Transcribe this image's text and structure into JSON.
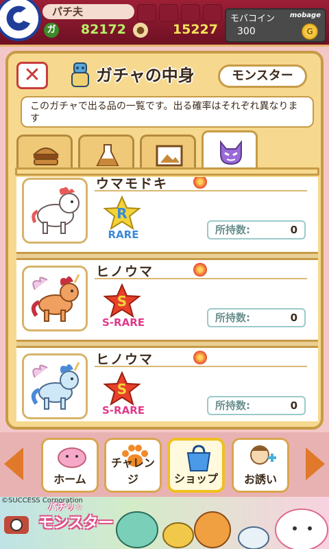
{
  "header": {
    "player_name": "パチ夫",
    "gold_icon": "ガ",
    "gold_value": "82172",
    "pet_value": "15227",
    "mobacoin_label": "モバコイン",
    "mobacoin_value": "300",
    "brand": "mobage"
  },
  "panel": {
    "close_label": "✕",
    "title": "ガチャの中身",
    "category": "モンスター",
    "description": "このガチャで出る品の一覧です。出る確率はそれぞれ異なります",
    "tabs": [
      {
        "icon": "burger-icon"
      },
      {
        "icon": "flask-icon"
      },
      {
        "icon": "picture-icon"
      },
      {
        "icon": "devil-icon",
        "active": true
      }
    ]
  },
  "items": [
    {
      "name": "ウマモドキ",
      "rank": "R",
      "rarity": "RARE",
      "owned_label": "所持数:",
      "owned": "0",
      "color": "#3a8ad8"
    },
    {
      "name": "ヒノウマ",
      "rank": "S",
      "rarity": "S-RARE",
      "owned_label": "所持数:",
      "owned": "0",
      "color": "#e03a8a"
    },
    {
      "name": "ヒノウマ",
      "rank": "S",
      "rarity": "S-RARE",
      "owned_label": "所持数:",
      "owned": "0",
      "color": "#e03a8a"
    }
  ],
  "nav": {
    "home": "ホーム",
    "challenge": "チャレンジ",
    "shop": "ショップ",
    "invite": "お誘い"
  },
  "banner": {
    "copyright": "©SUCCESS Corporation",
    "subtitle": "パチリ☆",
    "title": "モンスター"
  }
}
